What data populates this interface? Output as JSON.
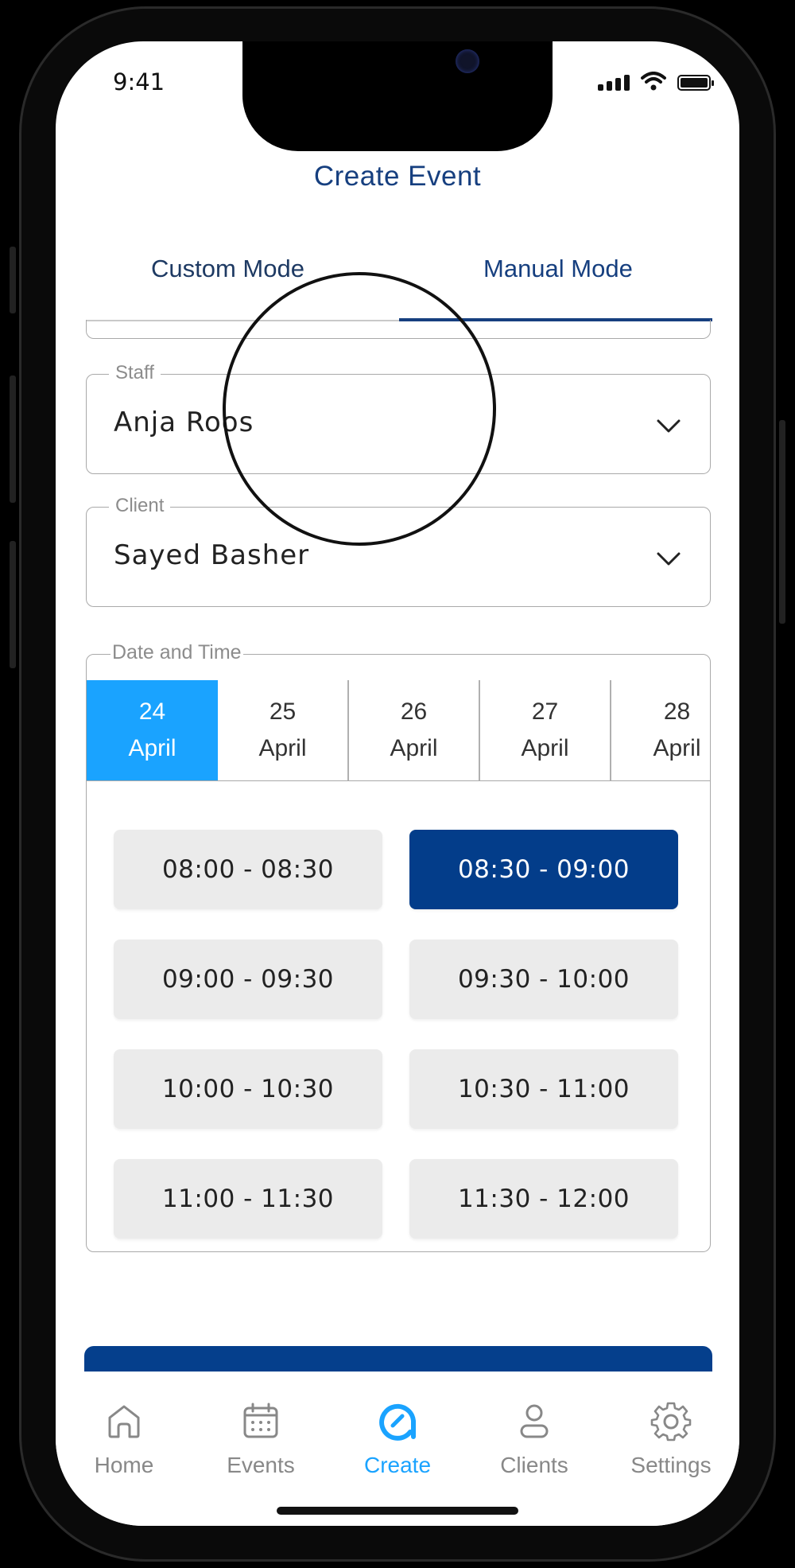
{
  "status_bar": {
    "time": "9:41"
  },
  "header": {
    "title": "Create Event"
  },
  "tabs": [
    {
      "label": "Custom Mode",
      "active": false
    },
    {
      "label": "Manual Mode",
      "active": true
    }
  ],
  "fields": {
    "staff": {
      "label": "Staff",
      "value": "Anja Roos"
    },
    "client": {
      "label": "Client",
      "value": "Sayed Basher"
    }
  },
  "date_time": {
    "label": "Date and Time",
    "dates": [
      {
        "day": "24",
        "month": "April",
        "selected": true
      },
      {
        "day": "25",
        "month": "April",
        "selected": false
      },
      {
        "day": "26",
        "month": "April",
        "selected": false
      },
      {
        "day": "27",
        "month": "April",
        "selected": false
      },
      {
        "day": "28",
        "month": "April",
        "selected": false
      }
    ],
    "slots": [
      {
        "label": "08:00 - 08:30",
        "selected": false
      },
      {
        "label": "08:30 - 09:00",
        "selected": true
      },
      {
        "label": "09:00 - 09:30",
        "selected": false
      },
      {
        "label": "09:30 - 10:00",
        "selected": false
      },
      {
        "label": "10:00 - 10:30",
        "selected": false
      },
      {
        "label": "10:30 - 11:00",
        "selected": false
      },
      {
        "label": "11:00 - 11:30",
        "selected": false
      },
      {
        "label": "11:30 - 12:00",
        "selected": false
      }
    ]
  },
  "nav": [
    {
      "label": "Home",
      "icon": "home-icon",
      "active": false
    },
    {
      "label": "Events",
      "icon": "calendar-icon",
      "active": false
    },
    {
      "label": "Create",
      "icon": "create-icon",
      "active": true
    },
    {
      "label": "Clients",
      "icon": "user-icon",
      "active": false
    },
    {
      "label": "Settings",
      "icon": "gear-icon",
      "active": false
    }
  ],
  "colors": {
    "primary": "#053f8c",
    "accent": "#1aa3ff",
    "title": "#163f7f",
    "slot_bg": "#ebebeb"
  }
}
